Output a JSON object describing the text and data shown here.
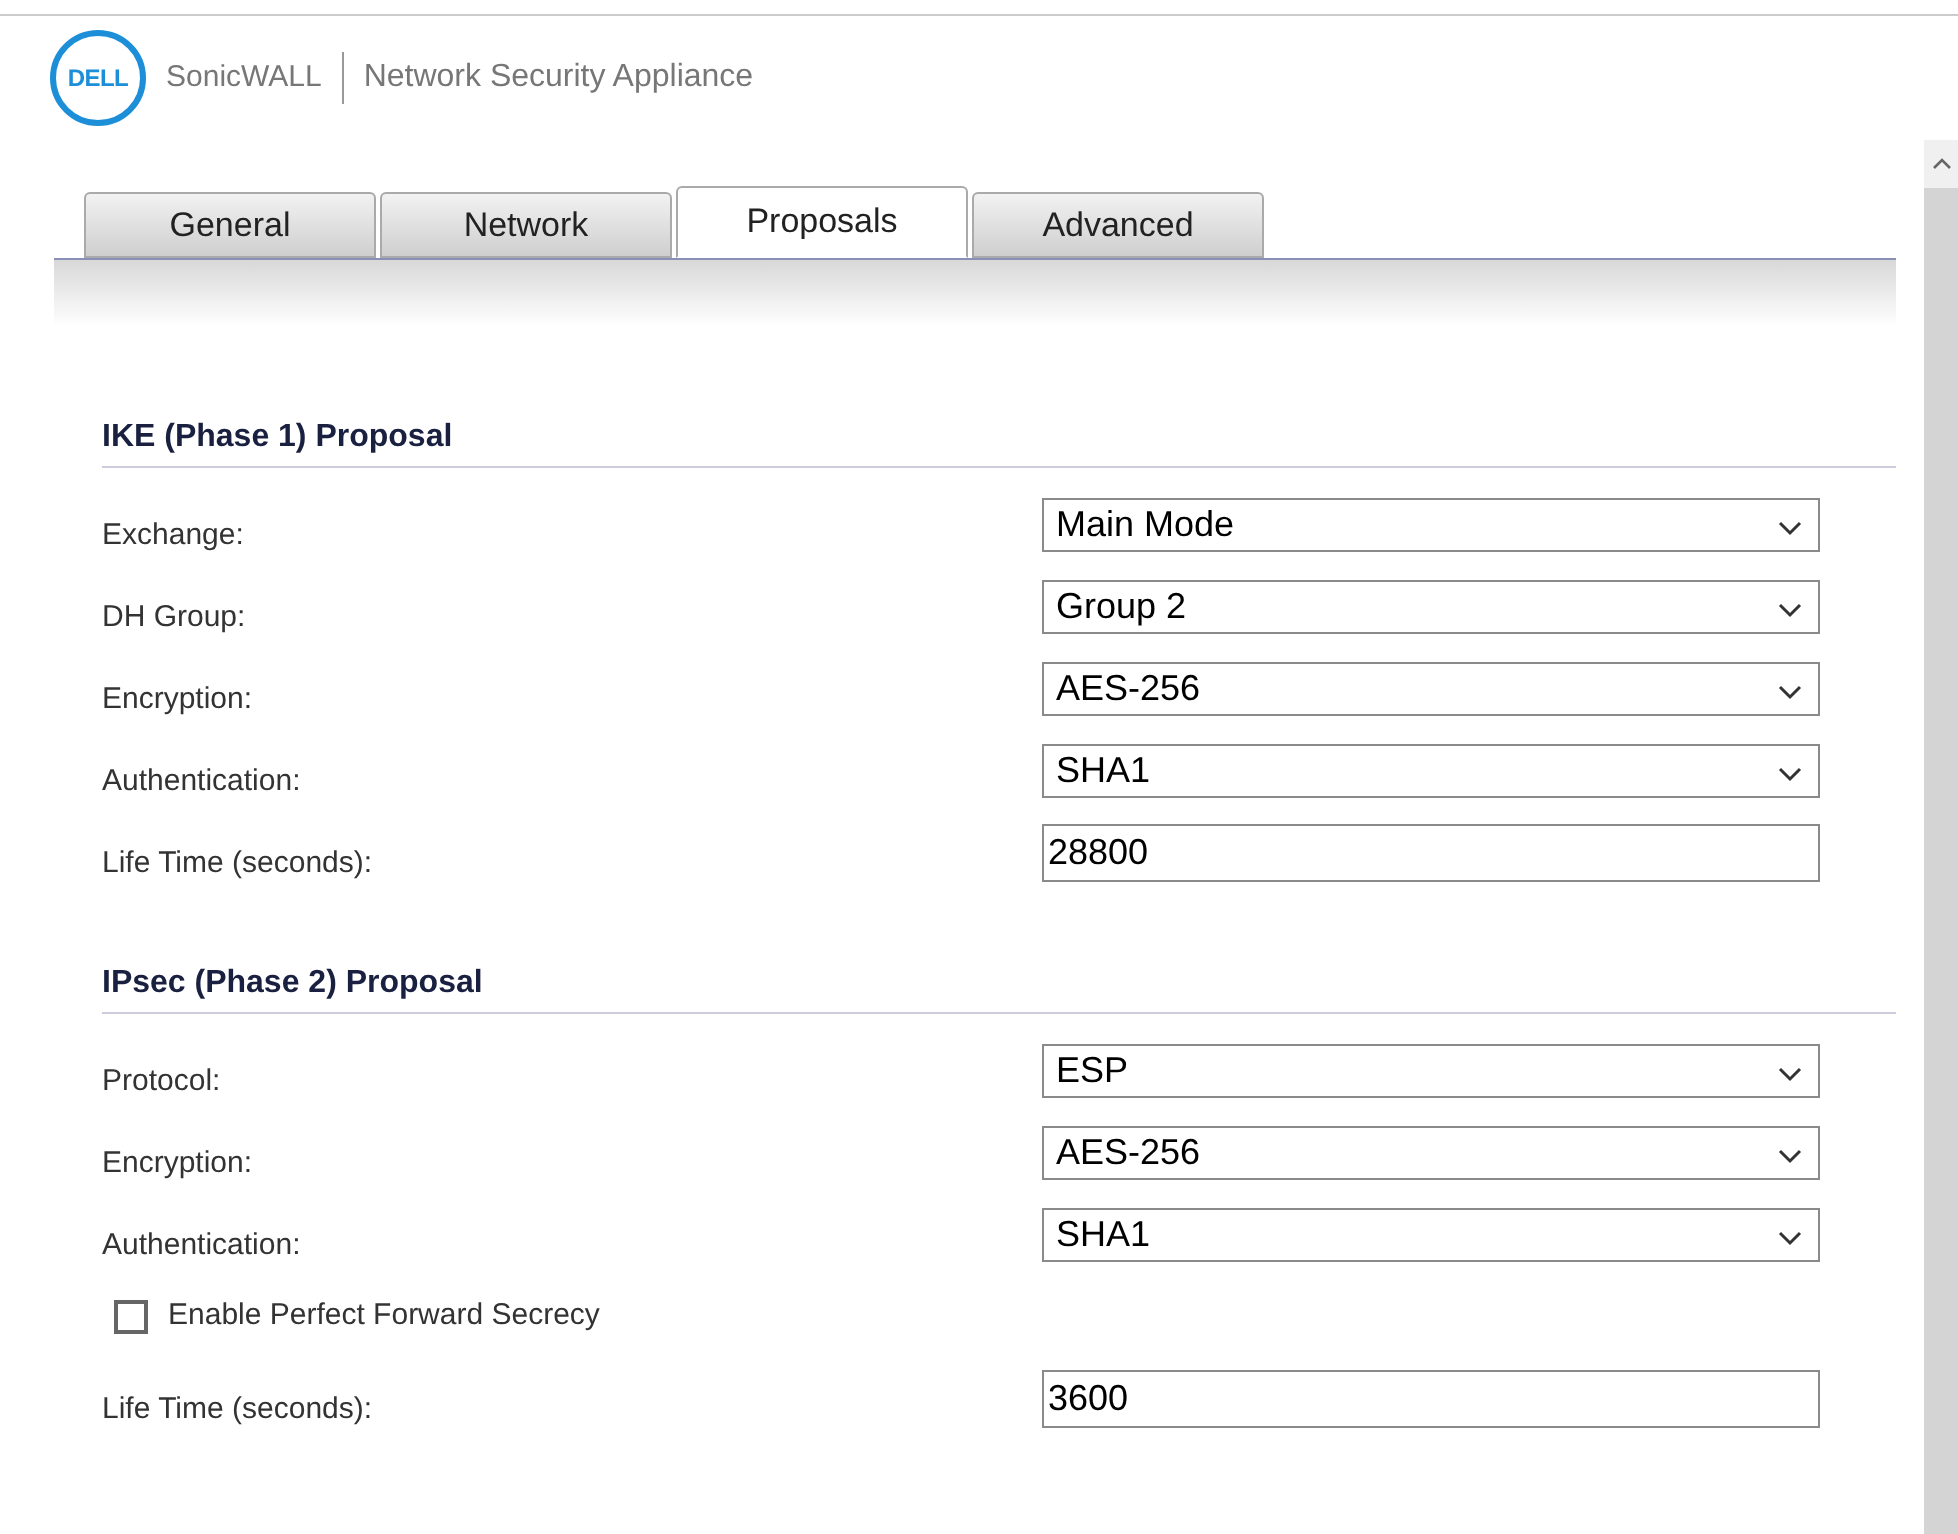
{
  "header": {
    "logo_text": "DELL",
    "brand": "SonicWALL",
    "product": "Network Security Appliance"
  },
  "tabs": [
    {
      "label": "General",
      "selected": false
    },
    {
      "label": "Network",
      "selected": false
    },
    {
      "label": "Proposals",
      "selected": true
    },
    {
      "label": "Advanced",
      "selected": false
    }
  ],
  "sections": [
    {
      "title": "IKE (Phase 1) Proposal",
      "rows": [
        {
          "kind": "select",
          "label": "Exchange:",
          "value": "Main Mode"
        },
        {
          "kind": "select",
          "label": "DH Group:",
          "value": "Group 2"
        },
        {
          "kind": "select",
          "label": "Encryption:",
          "value": "AES-256"
        },
        {
          "kind": "select",
          "label": "Authentication:",
          "value": "SHA1"
        },
        {
          "kind": "text",
          "label": "Life Time (seconds):",
          "value": "28800"
        }
      ]
    },
    {
      "title": "IPsec (Phase 2) Proposal",
      "rows": [
        {
          "kind": "select",
          "label": "Protocol:",
          "value": "ESP"
        },
        {
          "kind": "select",
          "label": "Encryption:",
          "value": "AES-256"
        },
        {
          "kind": "select",
          "label": "Authentication:",
          "value": "SHA1"
        },
        {
          "kind": "checkbox",
          "label": "Enable Perfect Forward Secrecy",
          "checked": false
        },
        {
          "kind": "text",
          "label": "Life Time (seconds):",
          "value": "3600"
        }
      ]
    }
  ]
}
